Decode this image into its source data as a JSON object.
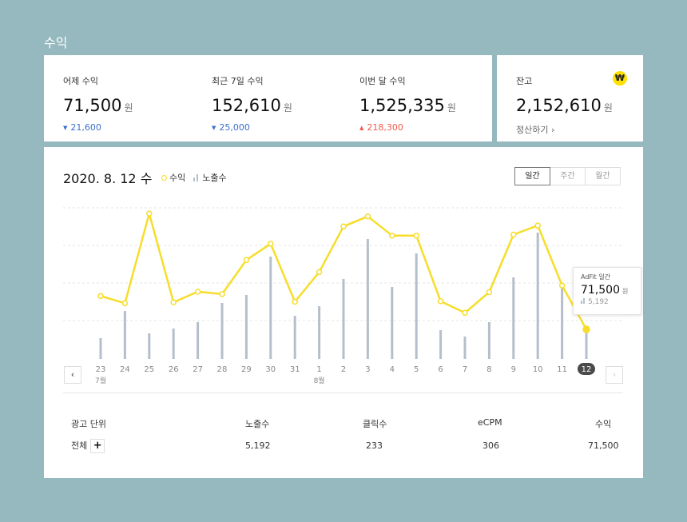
{
  "page_title": "수익",
  "stats": [
    {
      "label": "어제 수익",
      "value": "71,500",
      "unit": "원",
      "delta": "21,600",
      "delta_dir": "down"
    },
    {
      "label": "최근 7일 수익",
      "value": "152,610",
      "unit": "원",
      "delta": "25,000",
      "delta_dir": "down"
    },
    {
      "label": "이번 달 수익",
      "value": "1,525,335",
      "unit": "원",
      "delta": "218,300",
      "delta_dir": "up"
    }
  ],
  "balance": {
    "label": "잔고",
    "value": "2,152,610",
    "unit": "원",
    "link": "정산하기",
    "badge_icon": "won-coin-icon",
    "badge": "₩"
  },
  "chart_header": {
    "date": "2020. 8. 12 수",
    "legend_revenue": "수익",
    "legend_impressions": "노출수",
    "tabs": [
      "일간",
      "주간",
      "월간"
    ],
    "active_tab": "일간"
  },
  "tooltip": {
    "title": "AdFit 일간",
    "value": "71,500",
    "unit": "원",
    "sub": "5,192"
  },
  "nav": {
    "prev": "‹",
    "next": "›"
  },
  "chart_data": {
    "type": "line+bar",
    "categories": [
      "23",
      "24",
      "25",
      "26",
      "27",
      "28",
      "29",
      "30",
      "31",
      "1",
      "2",
      "3",
      "4",
      "5",
      "6",
      "7",
      "8",
      "9",
      "10",
      "11",
      "12"
    ],
    "month_labels": [
      {
        "index": 0,
        "label": "7월"
      },
      {
        "index": 9,
        "label": "8월"
      }
    ],
    "selected_index": 20,
    "series": [
      {
        "name": "수익",
        "kind": "line",
        "color": "#f7dd2a",
        "values": [
          141,
          126,
          313,
          128,
          150,
          145,
          216,
          250,
          129,
          191,
          286,
          307,
          267,
          267,
          130,
          106,
          149,
          269,
          288,
          163,
          71.5
        ]
      },
      {
        "name": "노출수",
        "kind": "bar",
        "color": "#b5bfcb",
        "values": [
          1.3,
          3.0,
          1.6,
          1.9,
          2.3,
          3.5,
          4.0,
          6.4,
          2.7,
          3.3,
          5.0,
          7.5,
          4.5,
          6.6,
          1.8,
          1.4,
          2.3,
          5.1,
          7.9,
          4.7,
          1.8
        ]
      }
    ],
    "grid": true
  },
  "table": {
    "headers": [
      "광고 단위",
      "노출수",
      "클릭수",
      "eCPM",
      "수익"
    ],
    "row": {
      "name": "전체",
      "add": "+",
      "impressions": "5,192",
      "clicks": "233",
      "ecpm": "306",
      "revenue": "71,500"
    }
  },
  "colors": {
    "background": "#95b9bf",
    "line": "#f7dd2a",
    "bar": "#b5bfcb",
    "down": "#3c6fcf",
    "up": "#ef5a4a",
    "badge": "#ffe000"
  }
}
